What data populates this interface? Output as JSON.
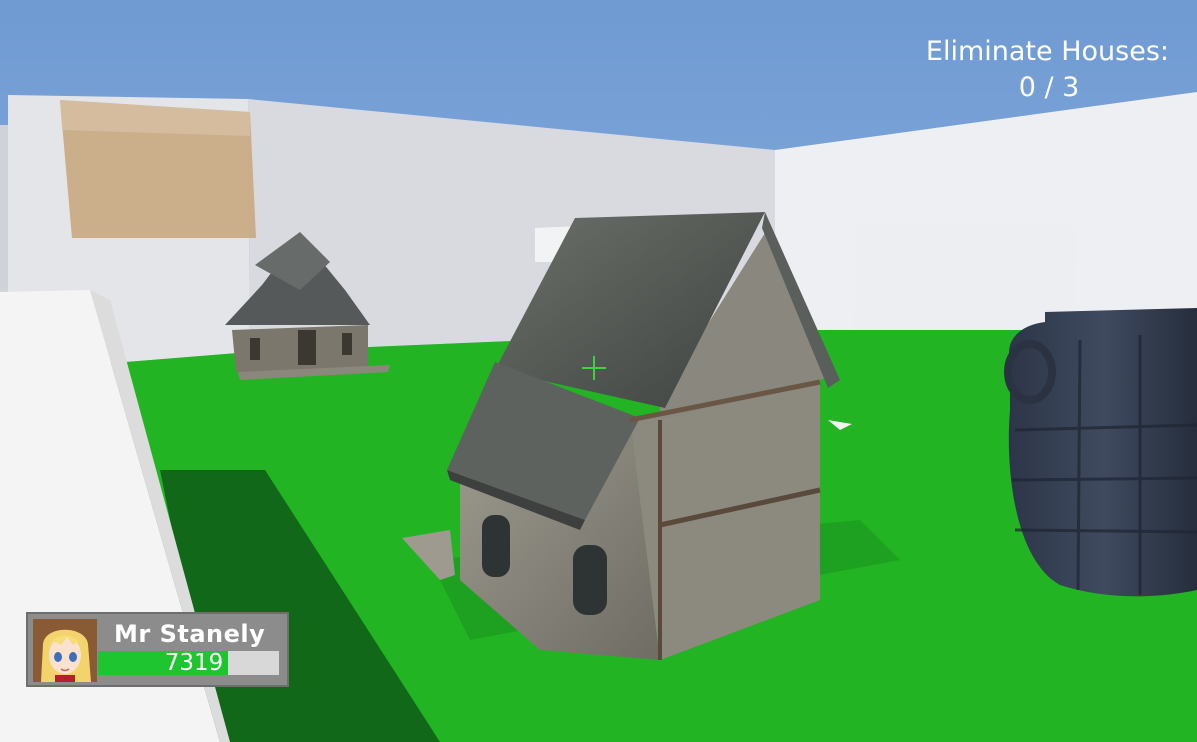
{
  "objective": {
    "label": "Eliminate Houses:",
    "progress_text": "0 / 3",
    "eliminated": 0,
    "total": 3
  },
  "player": {
    "name": "Mr Stanely",
    "health_text": "7319",
    "health_fraction": 0.72
  },
  "colors": {
    "sky": "#7aa6d9",
    "ground": "#1fb01f",
    "walls": "#e6e7eb",
    "health_fill": "#1fc431",
    "crosshair": "#3ed23e"
  },
  "icons": {
    "crosshair": "crosshair-icon",
    "avatar": "anime-girl-portrait"
  }
}
